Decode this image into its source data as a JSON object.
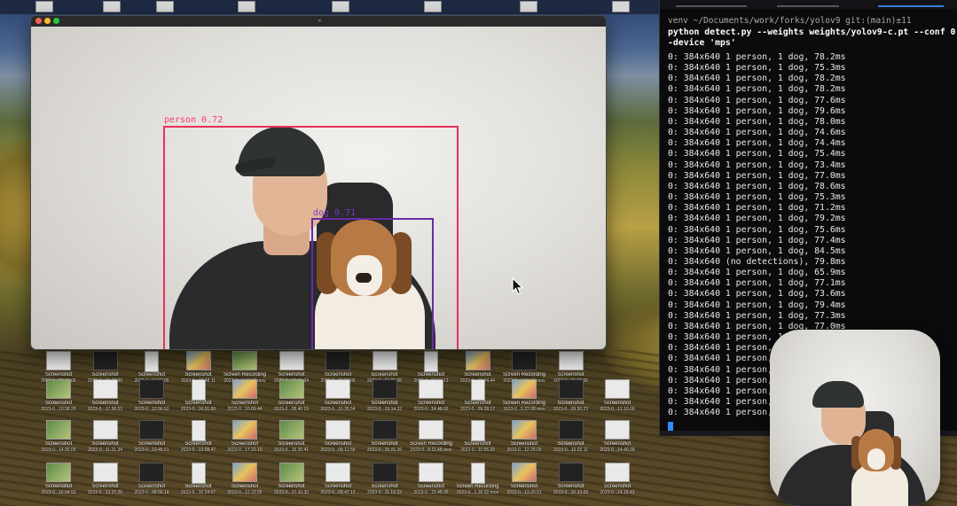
{
  "camera_window": {
    "title_glyph": "⚬",
    "detections": [
      {
        "label": "person 0.72"
      },
      {
        "label": "dog 0.71"
      }
    ]
  },
  "terminal": {
    "prompt": "venv ~/Documents/work/forks/yolov9 git:(main)±11",
    "command_line_1": "python detect.py --weights weights/yolov9-c.pt --conf 0.1 --source 0",
    "command_line_2": "-device 'mps'",
    "output_lines": [
      "0: 384x640 1 person, 1 dog, 78.2ms",
      "0: 384x640 1 person, 1 dog, 75.3ms",
      "0: 384x640 1 person, 1 dog, 78.2ms",
      "0: 384x640 1 person, 1 dog, 78.2ms",
      "0: 384x640 1 person, 1 dog, 77.6ms",
      "0: 384x640 1 person, 1 dog, 79.6ms",
      "0: 384x640 1 person, 1 dog, 78.0ms",
      "0: 384x640 1 person, 1 dog, 74.6ms",
      "0: 384x640 1 person, 1 dog, 74.4ms",
      "0: 384x640 1 person, 1 dog, 75.4ms",
      "0: 384x640 1 person, 1 dog, 73.4ms",
      "0: 384x640 1 person, 1 dog, 77.0ms",
      "0: 384x640 1 person, 1 dog, 78.6ms",
      "0: 384x640 1 person, 1 dog, 75.3ms",
      "0: 384x640 1 person, 1 dog, 71.2ms",
      "0: 384x640 1 person, 1 dog, 79.2ms",
      "0: 384x640 1 person, 1 dog, 75.6ms",
      "0: 384x640 1 person, 1 dog, 77.4ms",
      "0: 384x640 1 person, 1 dog, 84.5ms",
      "0: 384x640 (no detections), 79.8ms",
      "0: 384x640 1 person, 1 dog, 65.9ms",
      "0: 384x640 1 person, 1 dog, 77.1ms",
      "0: 384x640 1 person, 1 dog, 73.6ms",
      "0: 384x640 1 person, 1 dog, 79.4ms",
      "0: 384x640 1 person, 1 dog, 77.3ms",
      "0: 384x640 1 person, 1 dog, 77.0ms",
      "0: 384x640 1 person, 1 dog, 78.0ms",
      "0: 384x640 1 person, 1 dog, 75.1ms",
      "0: 384x640 1 person, 1 dog, 74.7ms",
      "0: 384x640 1 person, 1 dog, 76.8ms",
      "0: 384x640 1 person, 1 dog, 78.4ms",
      "0: 384x640 1 person, 1 dog, 77.9ms",
      "0: 384x640 1 person, 1 dog, 76.2ms",
      "0: 384x640 1 person, 1 dog, 79.0ms"
    ]
  },
  "desktop_icons": [
    {
      "name": "Screenshot",
      "meta": "2023-0...03.38.05"
    },
    {
      "name": "Screenshot",
      "meta": "2023-0...10.48.36"
    },
    {
      "name": "Screenshot",
      "meta": "2023-0...13.58.05"
    },
    {
      "name": "Screenshot",
      "meta": "2023-0...16.48.11"
    },
    {
      "name": "Screen Recording",
      "meta": "2023-0...3.56.07.mov"
    },
    {
      "name": "Screenshot",
      "meta": "2023-0...12.51.34"
    },
    {
      "name": "Screenshot",
      "meta": "2023-0...13.58.05"
    },
    {
      "name": "Screenshot",
      "meta": "2023-0...08.27.06"
    },
    {
      "name": "Screenshot",
      "meta": "2023-0...15.54.13"
    },
    {
      "name": "Screenshot",
      "meta": "2023-0...12.04.44"
    },
    {
      "name": "Screen Recording",
      "meta": "2023-0...4.50.06.mov"
    },
    {
      "name": "Screenshot",
      "meta": "2023-0...11.02.35"
    },
    {
      "name": "Screenshot",
      "meta": "2023-0...10.58.29"
    },
    {
      "name": "Screenshot",
      "meta": "2023-0...17.58.53"
    },
    {
      "name": "Screenshot",
      "meta": "2023-0...12.56.52"
    },
    {
      "name": "Screenshot",
      "meta": "2023-0...16.51.08"
    },
    {
      "name": "Screenshot",
      "meta": "2023-0...10.09.44"
    },
    {
      "name": "Screenshot",
      "meta": "2023-0...08.40.15"
    },
    {
      "name": "Screenshot",
      "meta": "2023-0...10.35.54"
    },
    {
      "name": "Screenshot",
      "meta": "2023-0...13.14.32"
    },
    {
      "name": "Screenshot",
      "meta": "2023-0...14.48.02"
    },
    {
      "name": "Screenshot",
      "meta": "2023-0...09.39.17"
    },
    {
      "name": "Screen Recording",
      "meta": "2023-0...5.22.08.mov"
    },
    {
      "name": "Screenshot",
      "meta": "2023-0...09.50.23"
    },
    {
      "name": "Screenshot",
      "meta": "2023-0...12.10.09"
    },
    {
      "name": "Screenshot",
      "meta": "2023-0...14.05.03"
    },
    {
      "name": "Screenshot",
      "meta": "2023-0...11.21.34"
    },
    {
      "name": "Screenshot",
      "meta": "2023-0...10.45.51"
    },
    {
      "name": "Screenshot",
      "meta": "2023-0...13.08.47"
    },
    {
      "name": "Screenshot",
      "meta": "2023-0...17.22.10"
    },
    {
      "name": "Screenshot",
      "meta": "2023-0...16.35.41"
    },
    {
      "name": "Screenshot",
      "meta": "2023-0...09.12.58"
    },
    {
      "name": "Screenshot",
      "meta": "2023-0...15.01.26"
    },
    {
      "name": "Screen Recording",
      "meta": "2023-0...9.11.48.mov"
    },
    {
      "name": "Screenshot",
      "meta": "2023-0...11.55.20"
    },
    {
      "name": "Screenshot",
      "meta": "2023-0...12.29.03"
    },
    {
      "name": "Screenshot",
      "meta": "2023-0...10.02.11"
    },
    {
      "name": "Screenshot",
      "meta": "2023-0...14.40.39"
    },
    {
      "name": "Screenshot",
      "meta": "2023-0...16.04.52"
    },
    {
      "name": "Screenshot",
      "meta": "2023-0...13.37.25"
    },
    {
      "name": "Screenshot",
      "meta": "2023-0...08.56.14"
    },
    {
      "name": "Screenshot",
      "meta": "2023-0...10.24.07"
    },
    {
      "name": "Screenshot",
      "meta": "2023-0...12.33.56"
    },
    {
      "name": "Screenshot",
      "meta": "2023-0...17.10.30"
    },
    {
      "name": "Screenshot",
      "meta": "2023-0...09.47.12"
    },
    {
      "name": "Screenshot",
      "meta": "2023-0...11.19.23"
    },
    {
      "name": "Screenshot",
      "meta": "2023-0...15.48.35"
    },
    {
      "name": "Screen Recording",
      "meta": "2023-0...1.36.02.mov"
    },
    {
      "name": "Screenshot",
      "meta": "2023-0...13.20.51"
    },
    {
      "name": "Screenshot",
      "meta": "2023-0...10.33.09"
    },
    {
      "name": "Screenshot",
      "meta": "2023-0...14.18.43"
    },
    {
      "name": "Screenshot",
      "meta": "2023-0...16.27.20"
    }
  ],
  "colors": {
    "person_box": "#e8305a",
    "dog_box": "#6a2aa8",
    "terminal_bg": "#0b0b0d",
    "terminal_cursor": "#2f8cff"
  }
}
